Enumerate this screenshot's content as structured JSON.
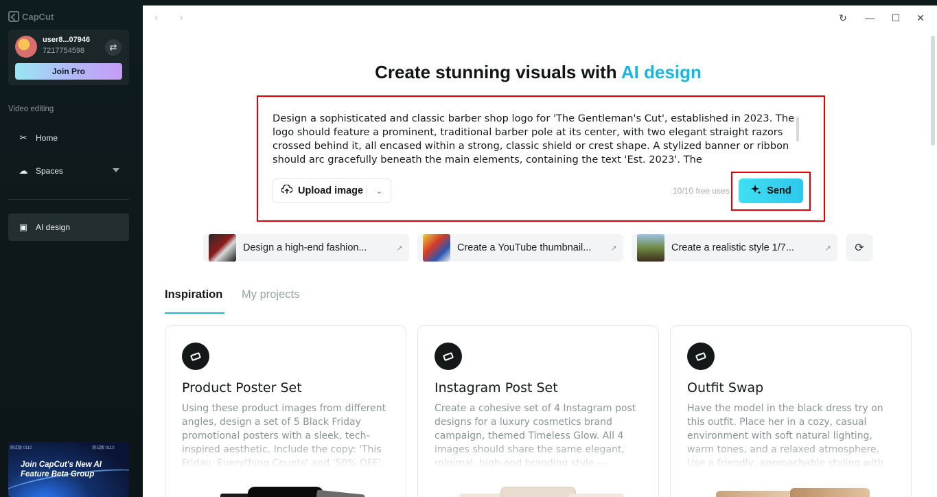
{
  "sidebar": {
    "brand": "CapCut",
    "user": {
      "name": "user8...07946",
      "id": "7217754598",
      "join_pro": "Join Pro"
    },
    "section_label": "Video editing",
    "nav": [
      {
        "label": "Home",
        "icon": "scissors-icon"
      },
      {
        "label": "Spaces",
        "icon": "cloud-icon"
      },
      {
        "label": "AI design",
        "icon": "ai-image-icon"
      }
    ],
    "promo": {
      "text": "Join CapCut's New AI Feature Beta Group",
      "tag": "测试版 0110"
    }
  },
  "headline": {
    "prefix": "Create stunning visuals with ",
    "accent": "AI design",
    "accent_color": "#19b6e0"
  },
  "prompt": {
    "text": "Design a sophisticated and classic barber shop logo for 'The Gentleman's Cut', established in 2023. The logo should feature a prominent, traditional barber pole at its center, with two elegant straight razors crossed behind it, all encased within a strong, classic shield or crest shape. A stylized banner or ribbon should arc gracefully beneath the main elements, containing the text 'Est. 2023'. The",
    "upload_label": "Upload image",
    "free_uses": "10/10 free uses",
    "send_label": "Send",
    "highlight_color": "#e00000"
  },
  "suggestions": [
    {
      "label": "Design a high-end fashion..."
    },
    {
      "label": "Create a YouTube thumbnail..."
    },
    {
      "label": "Create a realistic style 1/7..."
    }
  ],
  "tabs": [
    {
      "label": "Inspiration",
      "active": true
    },
    {
      "label": "My projects",
      "active": false
    }
  ],
  "cards": [
    {
      "title": "Product Poster Set",
      "desc": "Using these product images from different angles, design a set of 5 Black Friday promotional posters with a sleek, tech-inspired aesthetic. Include the copy: 'This Friday, Everything Counts' and '50% OFF'."
    },
    {
      "title": "Instagram Post Set",
      "desc": "Create a cohesive set of 4 Instagram post designs for a luxury cosmetics brand campaign, themed Timeless Glow. All 4 images should share the same elegant, minimal, high-end branding style — refined"
    },
    {
      "title": "Outfit Swap",
      "desc": "Have the model in the black dress try on this outfit. Place her in a cozy, casual environment with soft natural lighting, warm tones, and a relaxed atmosphere. Use a friendly, approachable styling with simple"
    }
  ]
}
